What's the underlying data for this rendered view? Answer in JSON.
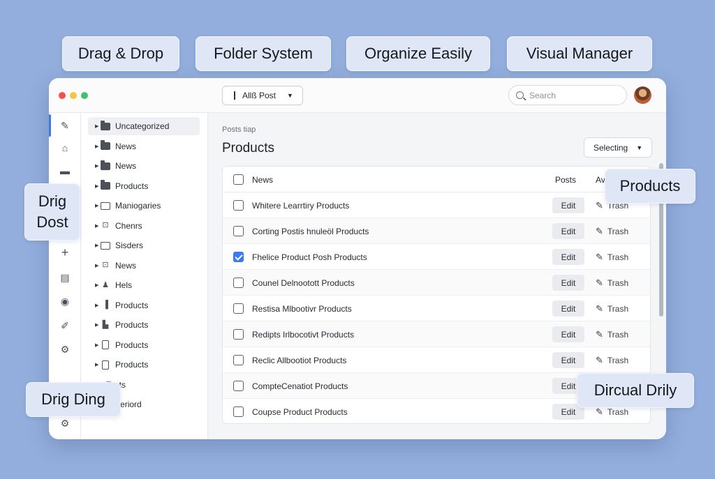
{
  "callouts": {
    "drag_drop": "Drag & Drop",
    "folder_system": "Folder System",
    "organize_easily": "Organize Easily",
    "visual_manager": "Visual Manager",
    "drig_dost_line1": "Drig",
    "drig_dost_line2": "Dost",
    "drig_ding": "Drig Ding",
    "products": "Products",
    "dircual_drily": "Dircual Drily"
  },
  "toolbar": {
    "post_select": "Allß Post",
    "search_placeholder": "Search"
  },
  "icons": {
    "pencil": "✎",
    "home": "⌂",
    "box": "▬",
    "plus": "+",
    "card": "▤",
    "eye": "◉",
    "brush": "✐",
    "gear": "⚙",
    "settings": "⚙"
  },
  "folders": [
    {
      "label": "Uncategorized",
      "icon": "fill"
    },
    {
      "label": "News",
      "icon": "fill"
    },
    {
      "label": "News",
      "icon": "fill"
    },
    {
      "label": "Products",
      "icon": "fill"
    },
    {
      "label": "Maniogaries",
      "icon": "out"
    },
    {
      "label": "Chenrs",
      "icon": "glyph",
      "glyph": "⊡"
    },
    {
      "label": "Sisders",
      "icon": "out"
    },
    {
      "label": "News",
      "icon": "glyph",
      "glyph": "⊡"
    },
    {
      "label": "Hels",
      "icon": "glyph",
      "glyph": "♟"
    },
    {
      "label": "Products",
      "icon": "glyph",
      "glyph": "▐"
    },
    {
      "label": "Products",
      "icon": "glyph",
      "glyph": "▙"
    },
    {
      "label": "Products",
      "icon": "doc"
    },
    {
      "label": "Products",
      "icon": "doc"
    },
    {
      "label": "Tosts",
      "icon": "none"
    },
    {
      "label": "pogeriord",
      "icon": "none"
    }
  ],
  "main": {
    "breadcrumb": "Posts tiap",
    "title": "Products",
    "selecting_button": "Selecting"
  },
  "table": {
    "header": {
      "name": "News",
      "posts": "Posts",
      "av": "Av"
    },
    "edit_label": "Edit",
    "trash_label": "Trash",
    "rows": [
      {
        "name": "Whitere Learrtiry Products",
        "checked": false
      },
      {
        "name": "Corting Postis hnuleöl Products",
        "checked": false
      },
      {
        "name": "Fhelice Product Posh Products",
        "checked": true
      },
      {
        "name": "Counel Delnootott Products",
        "checked": false
      },
      {
        "name": "Restisa Mlbootivr Products",
        "checked": false
      },
      {
        "name": "Redipts Irlbocotivt Products",
        "checked": false
      },
      {
        "name": "Reclic Allbootiot Products",
        "checked": false
      },
      {
        "name": "CompteCenatiot Products",
        "checked": false
      },
      {
        "name": "Coupse Product Products",
        "checked": false
      }
    ]
  },
  "colors": {
    "accent": "#3a7bf0",
    "background": "#93aedc",
    "callout": "#dfe7f7"
  }
}
